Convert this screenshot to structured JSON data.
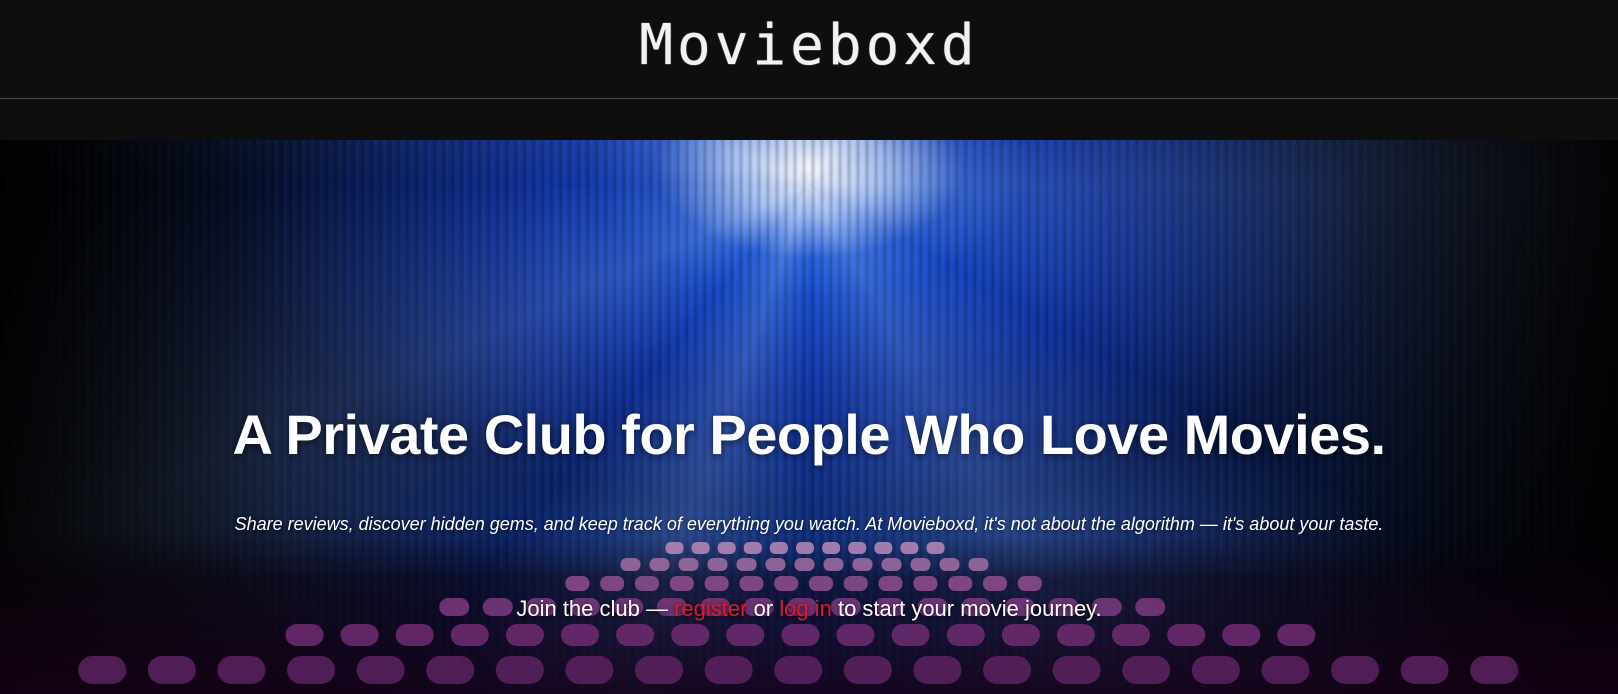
{
  "header": {
    "logo_text": "Movieboxd"
  },
  "hero": {
    "headline": "A Private Club for People Who Love Movies.",
    "subtext": "Share reviews, discover hidden gems, and keep track of everything you watch. At Movieboxd, it's not about the algorithm — it's about your taste.",
    "cta": {
      "prefix": "Join the club — ",
      "register_link": "register",
      "middle": " or ",
      "login_link": "log in",
      "suffix": " to start your movie journey."
    }
  },
  "colors": {
    "header_bg": "#0e0e0e",
    "link_red": "#e3182c",
    "text_white": "#ffffff"
  }
}
